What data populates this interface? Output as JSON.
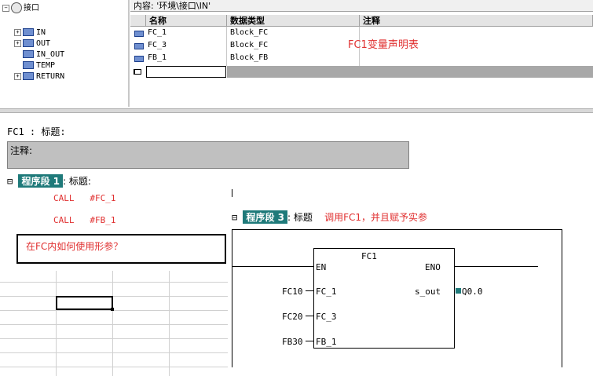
{
  "tree": {
    "root_label": "接口",
    "items": [
      {
        "label": "IN",
        "expand": "+"
      },
      {
        "label": "OUT",
        "expand": "+"
      },
      {
        "label": "IN_OUT",
        "expand": ""
      },
      {
        "label": "TEMP",
        "expand": ""
      },
      {
        "label": "RETURN",
        "expand": "+"
      }
    ],
    "root_expand": "−"
  },
  "decl": {
    "content_path": "内容: '环境\\接口\\IN'",
    "columns": [
      "名称",
      "数据类型",
      "注释"
    ],
    "rows": [
      {
        "name": "FC_1",
        "type": "Block_FC"
      },
      {
        "name": "FC_3",
        "type": "Block_FC"
      },
      {
        "name": "FB_1",
        "type": "Block_FB"
      }
    ],
    "annotation": "FC1变量声明表"
  },
  "editor": {
    "block_title": "FC1 : 标题:",
    "comment_label": "注释:",
    "network1": {
      "tag": "程序段 1",
      "title": ": 标题:",
      "expand": "⊟",
      "stl_lines": [
        "CALL   #FC_1",
        "CALL   #FB_1"
      ]
    },
    "network3": {
      "tag": "程序段 3",
      "title": ": 标题",
      "annotation": "调用FC1，并且赋予实参",
      "expand": "⊟"
    },
    "question": "在FC内如何使用形参？"
  },
  "fbd": {
    "block_name": "FC1",
    "en": "EN",
    "eno": "ENO",
    "inputs": [
      {
        "actual": "FC10",
        "formal": "FC_1"
      },
      {
        "actual": "FC20",
        "formal": "FC_3"
      },
      {
        "actual": "FB30",
        "formal": "FB_1"
      }
    ],
    "output": {
      "formal": "s_out",
      "actual": "Q0.0"
    }
  },
  "colors": {
    "accent_red": "#e03030",
    "network_tag": "#1f7a7a",
    "comment_bg": "#c0c0c0"
  }
}
